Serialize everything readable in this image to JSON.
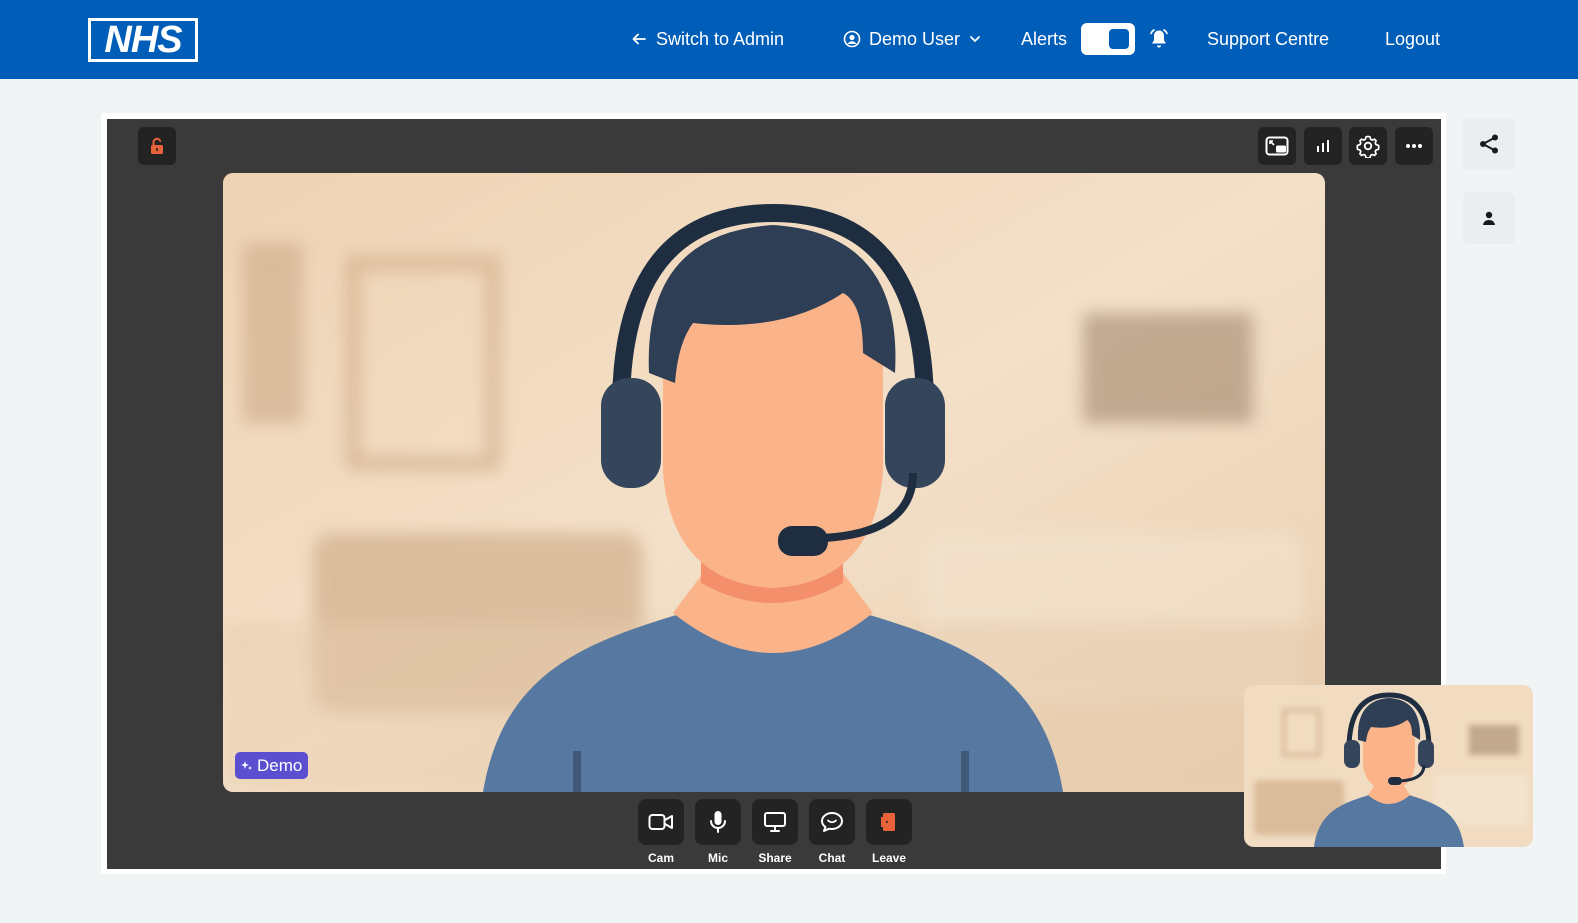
{
  "header": {
    "logo_text": "NHS",
    "switch_admin_label": "Switch to Admin",
    "user_label": "Demo User",
    "alerts_label": "Alerts",
    "alerts_toggle_on": true,
    "support_label": "Support Centre",
    "logout_label": "Logout"
  },
  "call": {
    "participant_tag": "Demo",
    "controls": [
      {
        "label": "Cam",
        "icon": "camera-icon"
      },
      {
        "label": "Mic",
        "icon": "microphone-icon"
      },
      {
        "label": "Share",
        "icon": "screen-share-icon"
      },
      {
        "label": "Chat",
        "icon": "chat-icon"
      },
      {
        "label": "Leave",
        "icon": "leave-door-icon"
      }
    ],
    "top_right_icons": [
      "picture-in-picture-icon",
      "signal-stats-icon",
      "settings-gear-icon",
      "more-options-icon"
    ],
    "lock_icon": "unlocked-padlock-icon"
  },
  "side": {
    "icons": [
      "share-icon",
      "person-icon"
    ]
  },
  "colors": {
    "header_bg": "#005eb8",
    "stage_bg": "#3a3a3a",
    "button_bg": "#232323",
    "leave_accent": "#e8623a",
    "demo_tag_bg": "#5b4fd0",
    "page_bg": "#f0f4f5"
  }
}
